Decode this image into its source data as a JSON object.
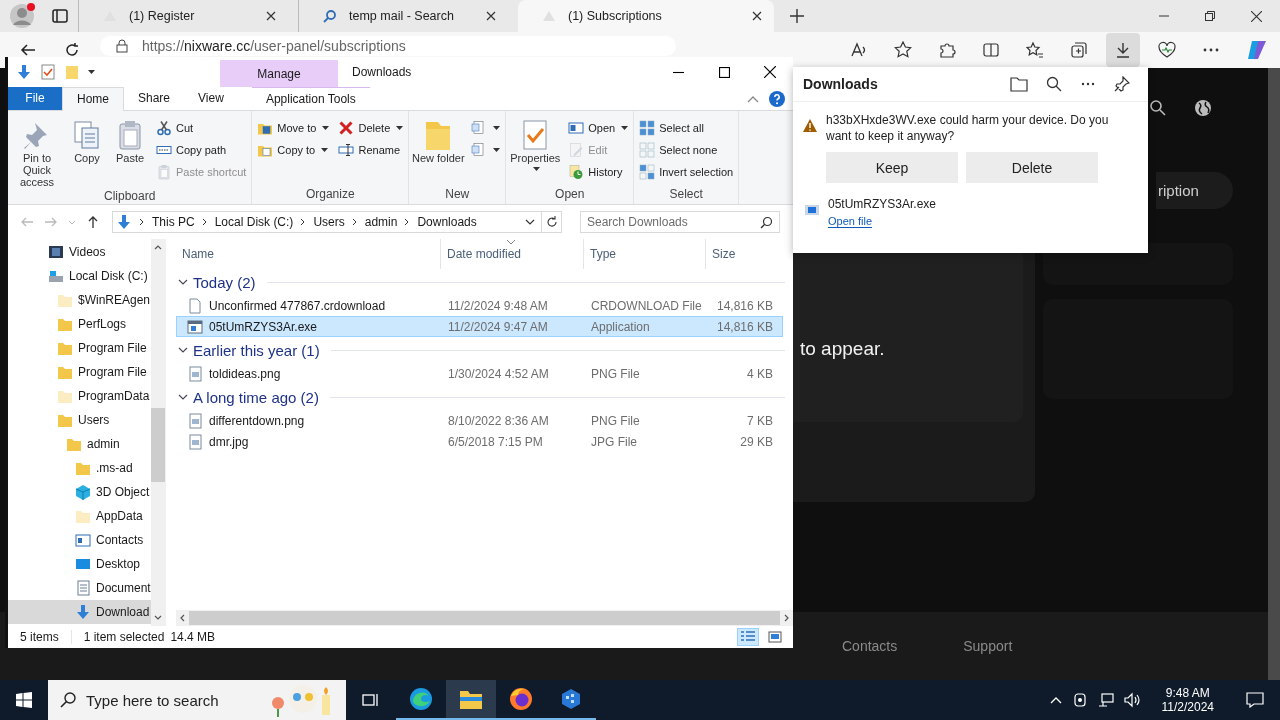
{
  "browser": {
    "tabs": [
      {
        "title": "(1) Register",
        "kind": "site",
        "selected": false
      },
      {
        "title": "temp mail - Search",
        "kind": "search",
        "selected": false
      },
      {
        "title": "(1) Subscriptions",
        "kind": "site",
        "selected": true
      }
    ],
    "address": {
      "scheme": "https://",
      "host": "nixware.cc",
      "path": "/user-panel/subscriptions"
    },
    "page": {
      "button_label": "ription",
      "message": "to appear.",
      "footer_links": [
        "Contacts",
        "Support"
      ]
    }
  },
  "explorer": {
    "title": "Downloads",
    "context_tab": "Manage",
    "ribbon_tabs": [
      {
        "label": "File",
        "kind": "file",
        "selected": false
      },
      {
        "label": "Home",
        "kind": "tab",
        "selected": true
      },
      {
        "label": "Share",
        "kind": "tab",
        "selected": false
      },
      {
        "label": "View",
        "kind": "tab",
        "selected": false
      },
      {
        "label": "Application Tools",
        "kind": "context",
        "selected": false
      }
    ],
    "ribbon_groups": [
      {
        "label": "Clipboard",
        "items": [
          {
            "kind": "large",
            "label": "Pin to Quick access",
            "disabled": false,
            "dropdown": false
          },
          {
            "kind": "large",
            "label": "Copy",
            "disabled": false,
            "dropdown": false
          },
          {
            "kind": "large",
            "label": "Paste",
            "disabled": false,
            "dropdown": false
          },
          {
            "kind": "column",
            "items": [
              {
                "label": "Cut",
                "disabled": false,
                "dropdown": false
              },
              {
                "label": "Copy path",
                "disabled": false,
                "dropdown": false
              },
              {
                "label": "Paste shortcut",
                "disabled": true,
                "dropdown": false
              }
            ]
          }
        ]
      },
      {
        "label": "Organize",
        "items": [
          {
            "kind": "column",
            "items": [
              {
                "label": "Move to",
                "disabled": false,
                "dropdown": true
              },
              {
                "label": "Copy to",
                "disabled": false,
                "dropdown": true
              }
            ]
          },
          {
            "kind": "column",
            "items": [
              {
                "label": "Delete",
                "disabled": false,
                "dropdown": true
              },
              {
                "label": "Rename",
                "disabled": false,
                "dropdown": false
              }
            ]
          }
        ]
      },
      {
        "label": "New",
        "items": [
          {
            "kind": "large",
            "label": "New folder",
            "disabled": false,
            "dropdown": false
          },
          {
            "kind": "column",
            "items": [
              {
                "disabled": false,
                "dropdown": true
              },
              {
                "disabled": false,
                "dropdown": true
              }
            ]
          }
        ]
      },
      {
        "label": "Open",
        "items": [
          {
            "kind": "large",
            "label": "Properties",
            "disabled": false,
            "dropdown": true
          },
          {
            "kind": "column",
            "items": [
              {
                "label": "Open",
                "disabled": false,
                "dropdown": true
              },
              {
                "label": "Edit",
                "disabled": true,
                "dropdown": false
              },
              {
                "label": "History",
                "disabled": false,
                "dropdown": false
              }
            ]
          }
        ]
      },
      {
        "label": "Select",
        "items": [
          {
            "kind": "column",
            "items": [
              {
                "label": "Select all",
                "disabled": false,
                "dropdown": false
              },
              {
                "label": "Select none",
                "disabled": false,
                "dropdown": false
              },
              {
                "label": "Invert selection",
                "disabled": false,
                "dropdown": false
              }
            ]
          }
        ]
      }
    ],
    "breadcrumb": [
      "This PC",
      "Local Disk (C:)",
      "Users",
      "admin",
      "Downloads"
    ],
    "search": {
      "placeholder": "Search Downloads"
    },
    "nav_tree": [
      {
        "label": "Videos",
        "kind": "videos",
        "selected": false
      },
      {
        "label": "Local Disk (C:)",
        "kind": "drive",
        "selected": false,
        "children": [
          {
            "label": "$WinREAgen",
            "kind": "folder-hidden",
            "selected": false
          },
          {
            "label": "PerfLogs",
            "kind": "folder",
            "selected": false
          },
          {
            "label": "Program File",
            "kind": "folder",
            "selected": false
          },
          {
            "label": "Program File",
            "kind": "folder",
            "selected": false
          },
          {
            "label": "ProgramData",
            "kind": "folder-hidden",
            "selected": false
          },
          {
            "label": "Users",
            "kind": "folder",
            "selected": false,
            "children": [
              {
                "label": "admin",
                "kind": "folder",
                "selected": false,
                "children": [
                  {
                    "label": ".ms-ad",
                    "kind": "folder",
                    "selected": false
                  },
                  {
                    "label": "3D Object",
                    "kind": "objects",
                    "selected": false
                  },
                  {
                    "label": "AppData",
                    "kind": "folder-hidden",
                    "selected": false
                  },
                  {
                    "label": "Contacts",
                    "kind": "contacts",
                    "selected": false
                  },
                  {
                    "label": "Desktop",
                    "kind": "desktop",
                    "selected": false
                  },
                  {
                    "label": "Document",
                    "kind": "documents",
                    "selected": false
                  },
                  {
                    "label": "Download",
                    "kind": "downloads",
                    "selected": true
                  }
                ]
              }
            ]
          }
        ]
      }
    ],
    "columns": [
      {
        "label": "Name",
        "sorted": false
      },
      {
        "label": "Date modified",
        "sorted": true
      },
      {
        "label": "Type",
        "sorted": false
      },
      {
        "label": "Size",
        "sorted": false
      }
    ],
    "groups": [
      {
        "title": "Today (2)",
        "expanded": true,
        "files": [
          {
            "name": "Unconfirmed 477867.crdownload",
            "date": "11/2/2024 9:48 AM",
            "type": "CRDOWNLOAD File",
            "size": "14,816 KB",
            "kind": "blank",
            "selected": false
          },
          {
            "name": "05tUmRZYS3Ar.exe",
            "date": "11/2/2024 9:47 AM",
            "type": "Application",
            "size": "14,816 KB",
            "kind": "application",
            "selected": true
          }
        ]
      },
      {
        "title": "Earlier this year (1)",
        "expanded": true,
        "files": [
          {
            "name": "toldideas.png",
            "date": "1/30/2024 4:52 AM",
            "type": "PNG File",
            "size": "4 KB",
            "kind": "image",
            "selected": false
          }
        ]
      },
      {
        "title": "A long time ago (2)",
        "expanded": true,
        "files": [
          {
            "name": "differentdown.png",
            "date": "8/10/2022 8:36 AM",
            "type": "PNG File",
            "size": "7 KB",
            "kind": "image",
            "selected": false
          },
          {
            "name": "dmr.jpg",
            "date": "6/5/2018 7:15 PM",
            "type": "JPG File",
            "size": "29 KB",
            "kind": "image",
            "selected": false
          }
        ]
      }
    ],
    "status": {
      "items": "5 items",
      "selection": "1 item selected",
      "size": "14.4 MB"
    },
    "views": [
      {
        "kind": "details",
        "selected": true
      },
      {
        "kind": "tiles",
        "selected": false
      }
    ]
  },
  "downloads_panel": {
    "title": "Downloads",
    "warning": {
      "text": "h33bXHxde3WV.exe could harm your device. Do you want to keep it anyway?",
      "buttons": [
        "Keep",
        "Delete"
      ]
    },
    "items": [
      {
        "name": "05tUmRZYS3Ar.exe",
        "action": "Open file"
      }
    ]
  },
  "taskbar": {
    "search_placeholder": "Type here to search",
    "apps": [
      {
        "kind": "taskview",
        "selected": false,
        "running": false
      },
      {
        "kind": "edge",
        "selected": false,
        "running": true
      },
      {
        "kind": "explorer",
        "selected": true,
        "running": true
      },
      {
        "kind": "firefox",
        "selected": false,
        "running": true
      },
      {
        "kind": "box",
        "selected": false,
        "running": true
      }
    ],
    "time": "9:48 AM",
    "date": "11/2/2024"
  }
}
